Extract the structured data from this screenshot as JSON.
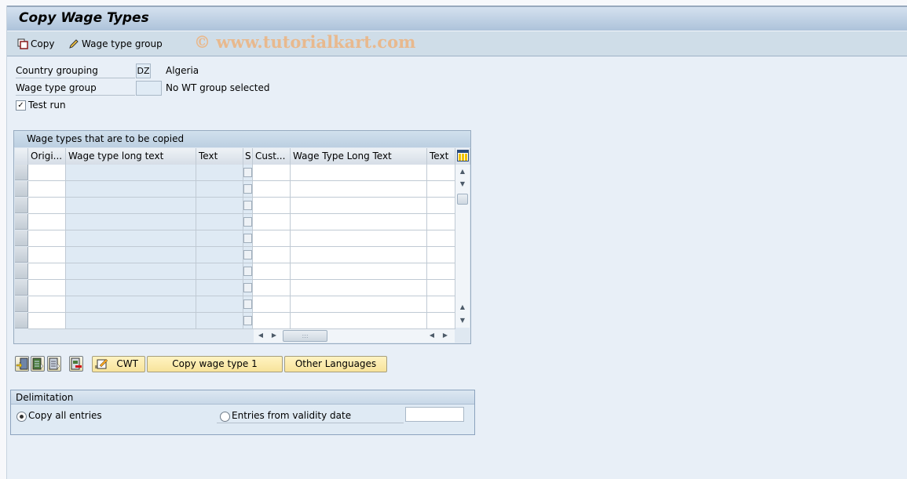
{
  "window": {
    "title": "Copy Wage Types"
  },
  "toolbar": {
    "copy_label": "Copy",
    "wage_type_group_label": "Wage type group",
    "watermark": "© www.tutorialkart.com"
  },
  "form": {
    "country_grouping": {
      "label": "Country grouping",
      "value": "DZ",
      "description": "Algeria"
    },
    "wage_type_group": {
      "label": "Wage type group",
      "value": "",
      "description": "No WT group selected"
    },
    "test_run": {
      "label": "Test run",
      "checked": true
    }
  },
  "table": {
    "title": "Wage types that are to be copied",
    "columns": [
      "Origi...",
      "Wage type long text",
      "Text",
      "S",
      "Cust...",
      "Wage Type Long Text",
      "Text"
    ],
    "row_count": 10,
    "rows": []
  },
  "buttons": {
    "icon_buttons": [
      "select-all-icon",
      "select-block-icon",
      "deselect-icon",
      "delete-row-icon"
    ],
    "cwt_label": "CWT",
    "copy_wage_type_label": "Copy wage type 1",
    "other_languages_label": "Other Languages"
  },
  "delimitation": {
    "title": "Delimitation",
    "options": [
      {
        "label": "Copy all entries",
        "selected": true
      },
      {
        "label": "Entries from validity date",
        "selected": false
      }
    ],
    "validity_date_value": ""
  }
}
